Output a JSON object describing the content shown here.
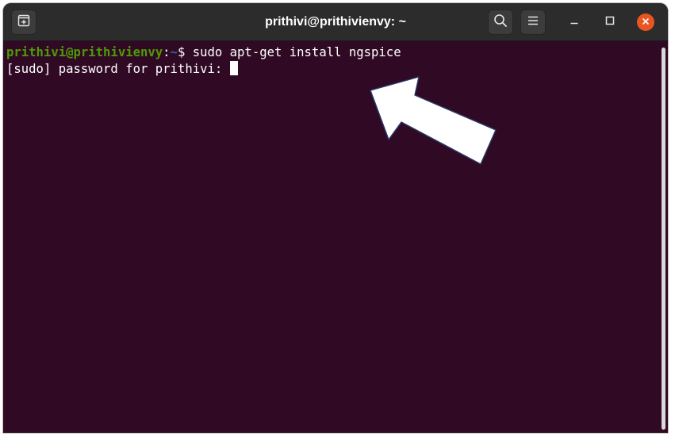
{
  "window": {
    "title": "prithivi@prithivienvy: ~"
  },
  "titlebar": {
    "new_tab_icon": "new-tab-icon",
    "search_icon": "search-icon",
    "menu_icon": "hamburger-menu-icon",
    "minimize_icon": "minimize-icon",
    "maximize_icon": "maximize-icon",
    "close_icon": "close-icon"
  },
  "terminal": {
    "line1": {
      "user_host": "prithivi@prithivienvy",
      "separator": ":",
      "path": "~",
      "prompt": "$",
      "command": " sudo apt-get install ngspice"
    },
    "line2": {
      "text": "[sudo] password for prithivi: "
    }
  },
  "colors": {
    "terminal_bg": "#300a24",
    "prompt_user": "#4e9a06",
    "prompt_path": "#3465a4",
    "close_button": "#e95420",
    "titlebar_bg": "#2c2c2c"
  },
  "annotation": {
    "arrow_icon": "pointer-arrow-icon"
  }
}
